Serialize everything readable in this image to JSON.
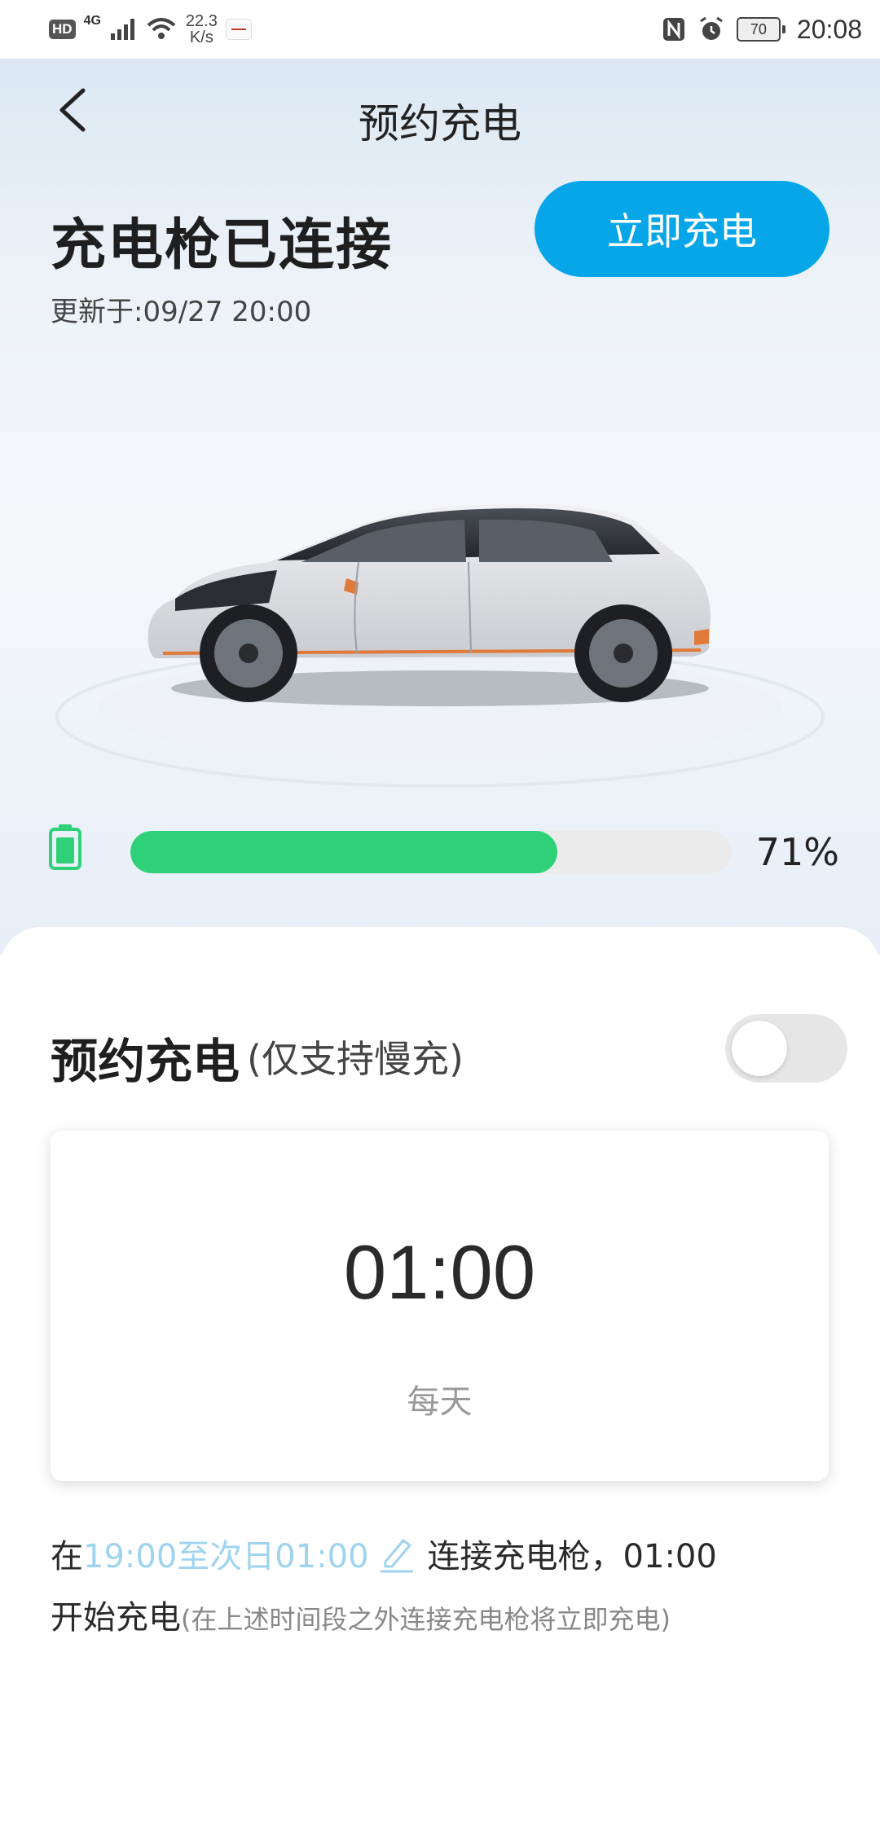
{
  "status_bar": {
    "hd_badge": "HD",
    "network_type": "4G",
    "speed_value": "22.3",
    "speed_unit": "K/s",
    "battery_level": "70",
    "time": "20:08",
    "icons": [
      "signal-icon",
      "wifi-icon",
      "byd-app-icon",
      "nfc-icon",
      "alarm-icon",
      "battery-icon"
    ]
  },
  "header": {
    "title": "预约充电",
    "back_icon": "chevron-left-icon"
  },
  "vehicle": {
    "connection_status": "充电枪已连接",
    "updated_at": "更新于:09/27 20:00",
    "charge_now_label": "立即充电",
    "battery_percent_text": "71%",
    "battery_fraction": 0.71
  },
  "schedule": {
    "title": "预约充电",
    "note": "(仅支持慢充)",
    "enabled": false,
    "time": "01:00",
    "repeat": "每天"
  },
  "description": {
    "prefix": "在",
    "window": "19:00至次日01:00",
    "middle": "连接充电枪，01:00",
    "line2_start": "开始充电",
    "line2_note": "(在上述时间段之外连接充电枪将立即充电)"
  },
  "colors": {
    "accent": "#06a6e8",
    "progress": "#2fd178",
    "link": "#9fd3ef"
  }
}
